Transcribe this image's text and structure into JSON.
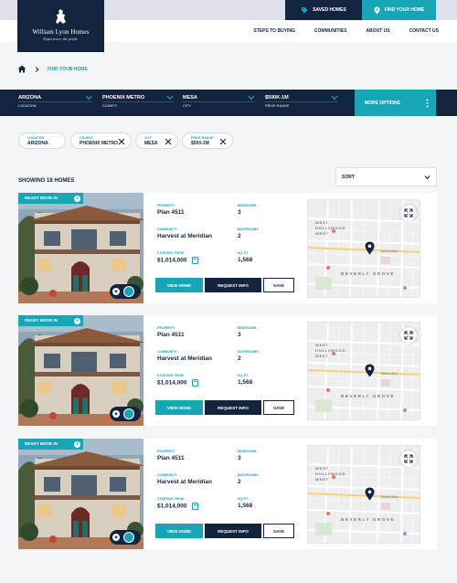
{
  "header": {
    "logo_name": "William Lyon Homes",
    "logo_tagline": "Experience the pride.",
    "saved_homes": "SAVED HOMES",
    "find_home": "FIND YOUR HOME",
    "nav": [
      "STEPS TO BUYING",
      "COMMUNITIES",
      "ABOUT US",
      "CONTACT US"
    ]
  },
  "breadcrumb": {
    "current": "FIND YOUR HOME"
  },
  "filters": [
    {
      "value": "ARIZONA",
      "label": "LOCATION"
    },
    {
      "value": "PHOENIX METRO",
      "label": "COUNTY"
    },
    {
      "value": "MESA",
      "label": "CITY"
    },
    {
      "value": "$500K-1M",
      "label": "PRICE RANGE"
    }
  ],
  "more_options": "MORE OPTIONS",
  "chips": [
    {
      "title": "LOCATION",
      "value": "ARIZONA",
      "removable": false
    },
    {
      "title": "COUNTY",
      "value": "PHOENIX METRO",
      "removable": true
    },
    {
      "title": "CITY",
      "value": "MESA",
      "removable": true
    },
    {
      "title": "PRICE RANGE",
      "value": "$500-1M",
      "removable": true
    }
  ],
  "results": {
    "count_text": "SHOWING 18 HOMES",
    "sort_label": "SORT"
  },
  "labels": {
    "property": "PROPERTY",
    "bedrooms": "BEDROOMS",
    "community": "COMMUNITY",
    "bathrooms": "BATHROOMS",
    "starting_from": "STARTING FROM",
    "sqft": "SQ. FT.",
    "view_home": "VIEW HOME",
    "request_info": "REQUEST INFO",
    "save": "SAVE"
  },
  "listings": [
    {
      "badge": "READY MOVE IN",
      "property": "Plan 4511",
      "bedrooms": "3",
      "community": "Harvest at Meridian",
      "bathrooms": "2",
      "price": "$1,014,000",
      "sqft": "1,568"
    },
    {
      "badge": "READY MOVE IN",
      "property": "Plan 4511",
      "bedrooms": "3",
      "community": "Harvest at Meridian",
      "bathrooms": "2",
      "price": "$1,014,000",
      "sqft": "1,568"
    },
    {
      "badge": "READY MOVE IN",
      "property": "Plan 4511",
      "bedrooms": "3",
      "community": "Harvest at Meridian",
      "bathrooms": "2",
      "price": "$1,014,000",
      "sqft": "1,568"
    }
  ],
  "map_labels": {
    "area": "WEST HOLLYWOOD WEST",
    "area_line1": "WEST",
    "area_line2": "HOLLYWOOD",
    "area_line3": "WEST",
    "district": "BEVERLY GROVE",
    "street": "Beverly Blvd"
  },
  "colors": {
    "navy": "#13243f",
    "teal": "#16a6b6",
    "background": "#f4f5f7"
  },
  "icons": [
    "tag-icon",
    "location-pin-icon",
    "home-icon",
    "chevron-right-icon",
    "chevron-down-icon",
    "close-icon",
    "more-vertical-icon",
    "info-icon",
    "calculator-icon",
    "expand-icon",
    "map-pin-icon"
  ]
}
